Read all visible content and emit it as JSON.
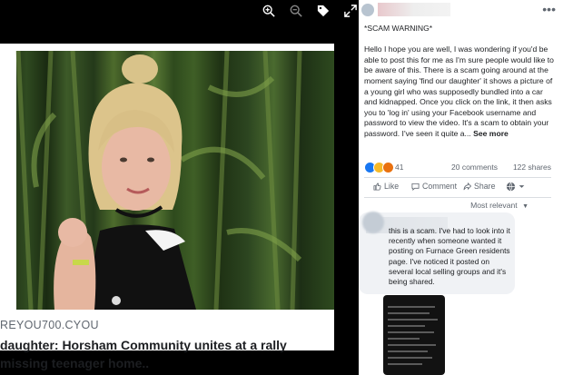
{
  "toolbar": {
    "icons": [
      "zoom-in-icon",
      "zoom-out-icon",
      "tag-icon",
      "fullscreen-icon"
    ]
  },
  "link_card": {
    "source": "REYOU700.CYOU",
    "headline_line1": "daughter: Horsham Community unites at a rally",
    "headline_line2": "missing teenager home.."
  },
  "post": {
    "text": "*SCAM WARNING*\n\nHello I hope you are well, I was wondering if you'd be able to post this for me as I'm sure people would like to be aware of this. There is a scam going around at the moment saying 'find our daughter' it shows a picture of a young girl who was supposedly bundled into a car and kidnapped. Once you click on the link, it then asks you to 'log in' using your Facebook username and password to view the video. It's a scam to obtain your password. I've seen it quite a...",
    "see_more": "See more",
    "reaction_count": "41",
    "comments_count": "20 comments",
    "shares_count": "122 shares",
    "reaction_colors": [
      "#1877f2",
      "#f7b928",
      "#e9710f"
    ]
  },
  "actions": {
    "like": "Like",
    "comment": "Comment",
    "share": "Share"
  },
  "sort": {
    "label": "Most relevant"
  },
  "comment": {
    "text": "this is a scam. I've had to look into it recently when someone wanted it posting on Furnace Green residents page. I've noticed it posted on several local selling groups and it's being shared."
  },
  "colors": {
    "link_domain": "#606770",
    "panel_bg": "#ffffff",
    "bubble_bg": "#f0f2f5"
  }
}
